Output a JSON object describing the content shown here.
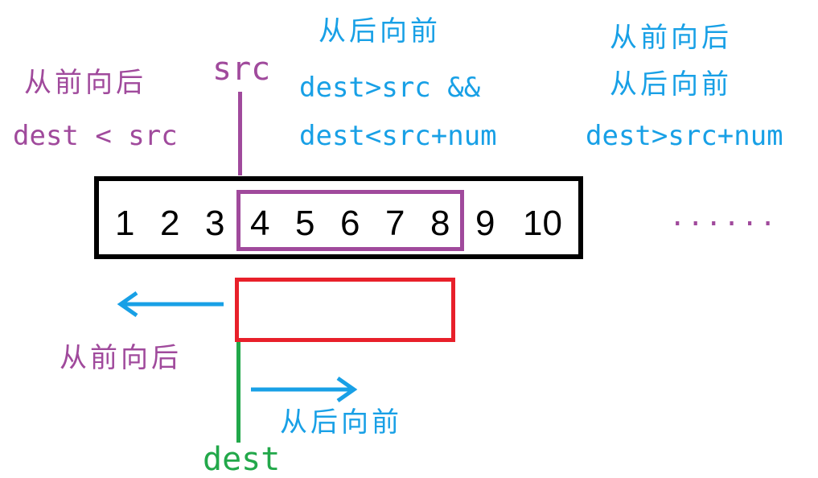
{
  "labels": {
    "src": "src",
    "dest": "dest",
    "left_top_direction": "从前向后",
    "left_condition": "dest < src",
    "mid_direction": "从后向前",
    "mid_condition_1": "dest>src &&",
    "mid_condition_2": "dest<src+num",
    "right_direction_1": "从前向后",
    "right_direction_2": "从后向前",
    "right_condition": "dest>src+num",
    "arrow_left_label": "从前向后",
    "arrow_right_label": "从后向前",
    "ellipsis": "......"
  },
  "array": [
    "1",
    "2",
    "3",
    "4",
    "5",
    "6",
    "7",
    "8",
    "9",
    "10"
  ],
  "colors": {
    "purple": "#a04a9c",
    "blue": "#18a0e6",
    "red": "#e8202a",
    "green": "#22a84a",
    "black": "#000000"
  }
}
